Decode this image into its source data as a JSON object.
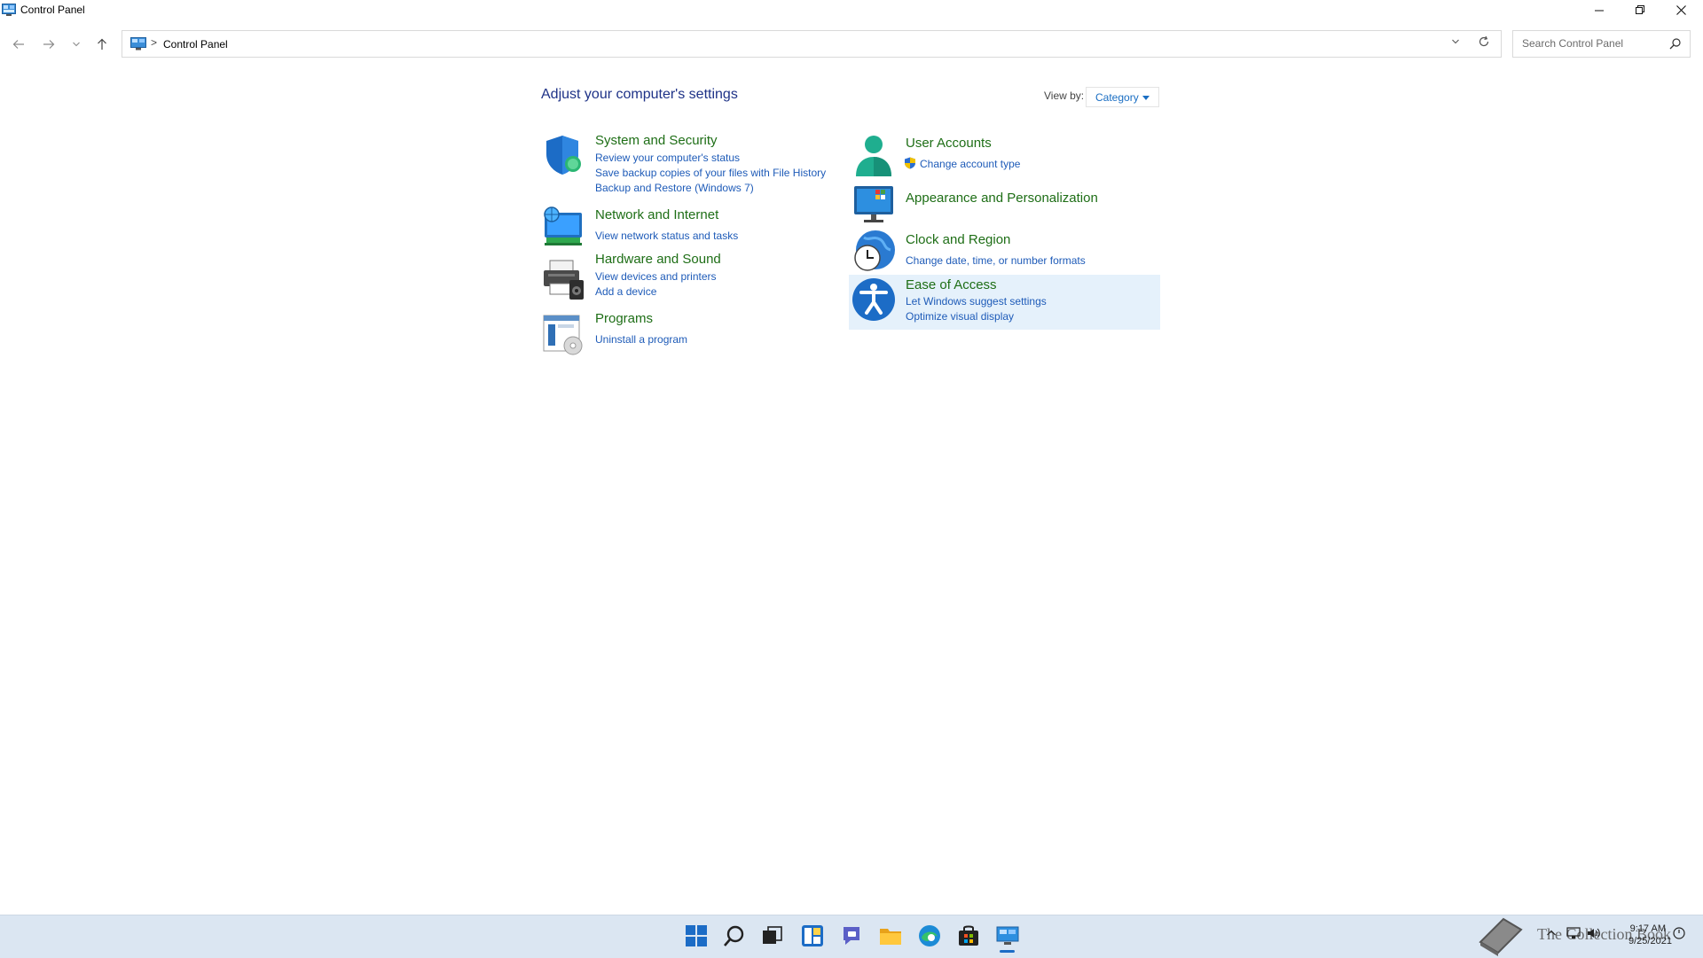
{
  "window": {
    "title": "Control Panel",
    "minimize_icon": "minimize-icon",
    "restore_icon": "restore-icon",
    "close_icon": "close-icon"
  },
  "address": {
    "back_icon": "back-arrow-icon",
    "forward_icon": "forward-arrow-icon",
    "recent_icon": "chevron-down-icon",
    "up_icon": "up-arrow-icon",
    "separator": ">",
    "crumb": "Control Panel",
    "search_placeholder": "Search Control Panel"
  },
  "main": {
    "heading": "Adjust your computer's settings",
    "view_by_label": "View by:",
    "view_by_value": "Category",
    "categories": [
      {
        "title": "System and Security",
        "icon": "shield-icon",
        "links": [
          "Review your computer's status",
          "Save backup copies of your files with File History",
          "Backup and Restore (Windows 7)"
        ]
      },
      {
        "title": "Network and Internet",
        "icon": "network-globe-icon",
        "links": [
          "View network status and tasks"
        ]
      },
      {
        "title": "Hardware and Sound",
        "icon": "printer-speaker-icon",
        "links": [
          "View devices and printers",
          "Add a device"
        ]
      },
      {
        "title": "Programs",
        "icon": "programs-icon",
        "links": [
          "Uninstall a program"
        ]
      },
      {
        "title": "User Accounts",
        "icon": "user-icon",
        "links": [
          "Change account type"
        ]
      },
      {
        "title": "Appearance and Personalization",
        "icon": "monitor-icon",
        "links": []
      },
      {
        "title": "Clock and Region",
        "icon": "clock-globe-icon",
        "links": [
          "Change date, time, or number formats"
        ]
      },
      {
        "title": "Ease of Access",
        "icon": "accessibility-icon",
        "links": [
          "Let Windows suggest settings",
          "Optimize visual display"
        ]
      }
    ]
  },
  "taskbar": {
    "items": [
      "start-icon",
      "search-icon",
      "task-view-icon",
      "widgets-icon",
      "chat-icon",
      "file-explorer-icon",
      "edge-icon",
      "store-icon",
      "control-panel-icon"
    ],
    "watermark": "The Collection Book",
    "time": "9:17 AM",
    "date": "9/25/2021"
  },
  "colors": {
    "accent": "#1c6cc6",
    "category_title": "#1e6e16",
    "link": "#1e5bb8",
    "heading": "#1e3287",
    "hover_highlight": "#e5f1fb",
    "taskbar": "#dbe6f2"
  }
}
